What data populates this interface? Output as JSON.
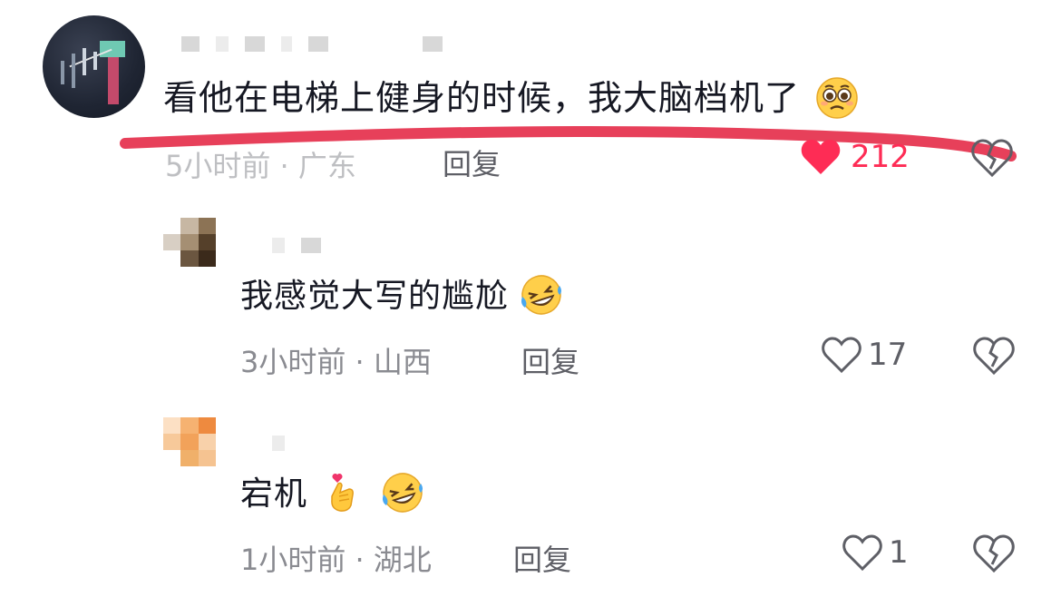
{
  "main_comment": {
    "text": "看他在电梯上健身的时候，我大脑档机了",
    "meta": "5小时前 · 广东",
    "reply": "回复",
    "likes": "212"
  },
  "replies": [
    {
      "text": "我感觉大写的尴尬",
      "meta": "3小时前 · 山西",
      "reply": "回复",
      "likes": "17"
    },
    {
      "text": "宕机",
      "meta": "1小时前 · 湖北",
      "reply": "回复",
      "likes": "1"
    }
  ],
  "icons": {
    "like_filled": "heart-filled-icon",
    "like_outline": "heart-outline-icon",
    "dislike": "broken-heart-icon",
    "emoji_pleading": "pleading-face-emoji",
    "emoji_laugh": "rolling-laughing-emoji",
    "emoji_finger_heart": "finger-heart-emoji"
  },
  "colors": {
    "accent_like": "#fe2c55",
    "annotation_underline": "#e7405a"
  }
}
